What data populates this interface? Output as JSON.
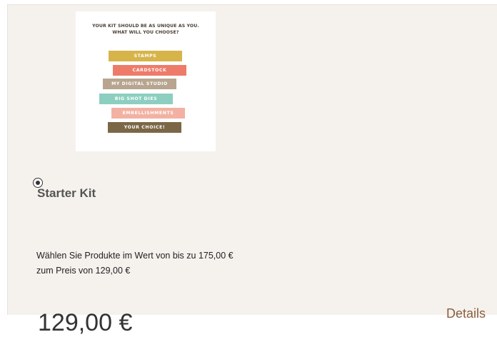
{
  "product": {
    "image": {
      "heading_line1": "YOUR KIT SHOULD BE AS UNIQUE AS YOU.",
      "heading_line2": "WHAT WILL YOU CHOOSE?",
      "strips": [
        {
          "label": "STAMPS",
          "color": "#d6b44a"
        },
        {
          "label": "CARDSTOCK",
          "color": "#ee7b6a"
        },
        {
          "label": "MY DIGITAL STUDIO",
          "color": "#b7a58f"
        },
        {
          "label": "BIG SHOT DIES",
          "color": "#8ccfc0"
        },
        {
          "label": "EMBELLISHMENTS",
          "color": "#f2b1a2"
        },
        {
          "label": "YOUR CHOICE!",
          "color": "#7b6746"
        }
      ]
    },
    "title": "Starter Kit",
    "description_line1": "Wählen Sie Produkte im Wert von bis zu 175,00 €",
    "description_line2": "zum Preis von 129,00 €",
    "price": "129,00 €",
    "details_label": "Details"
  },
  "colors": {
    "card_background": "#f5f2ee",
    "link": "#8b5e3c"
  }
}
